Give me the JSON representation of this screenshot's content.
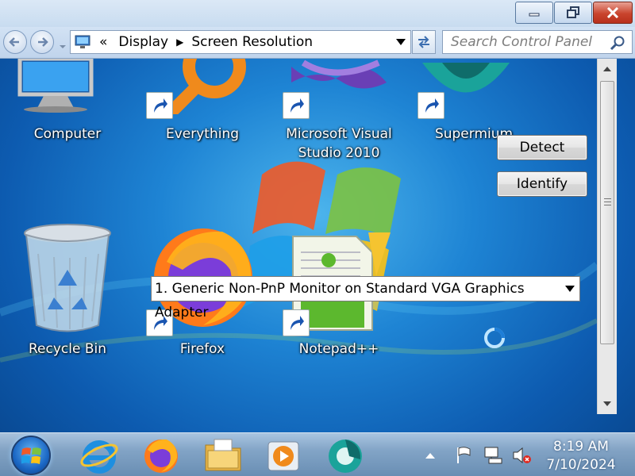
{
  "window": {
    "controls": {
      "minimize_icon": "minimize-icon",
      "restore_icon": "restore-icon",
      "close_icon": "close-icon"
    }
  },
  "address_bar": {
    "overflow": "«",
    "breadcrumb": [
      "Display",
      "Screen Resolution"
    ],
    "search_placeholder": "Search Control Panel"
  },
  "desktop": {
    "icons": {
      "computer": "Computer",
      "everything": "Everything",
      "visual_studio_line1": "Microsoft Visual",
      "visual_studio_line2": "Studio 2010",
      "supermium": "Supermium",
      "recycle_bin": "Recycle Bin",
      "firefox": "Firefox",
      "notepadpp": "Notepad++"
    }
  },
  "screen_resolution": {
    "detect_label": "Detect",
    "identify_label": "Identify",
    "monitor_selected": "1. Generic Non-PnP Monitor on Standard VGA Graphics Adapter"
  },
  "taskbar": {
    "apps": [
      "internet-explorer-icon",
      "firefox-icon",
      "file-explorer-icon",
      "media-player-icon",
      "supermium-icon"
    ],
    "time": "8:19 AM",
    "date": "7/10/2024"
  },
  "colors": {
    "close_red": "#c9442d",
    "desktop_blue": "#1e84d4",
    "chrome_blue": "#c8dcf0"
  }
}
